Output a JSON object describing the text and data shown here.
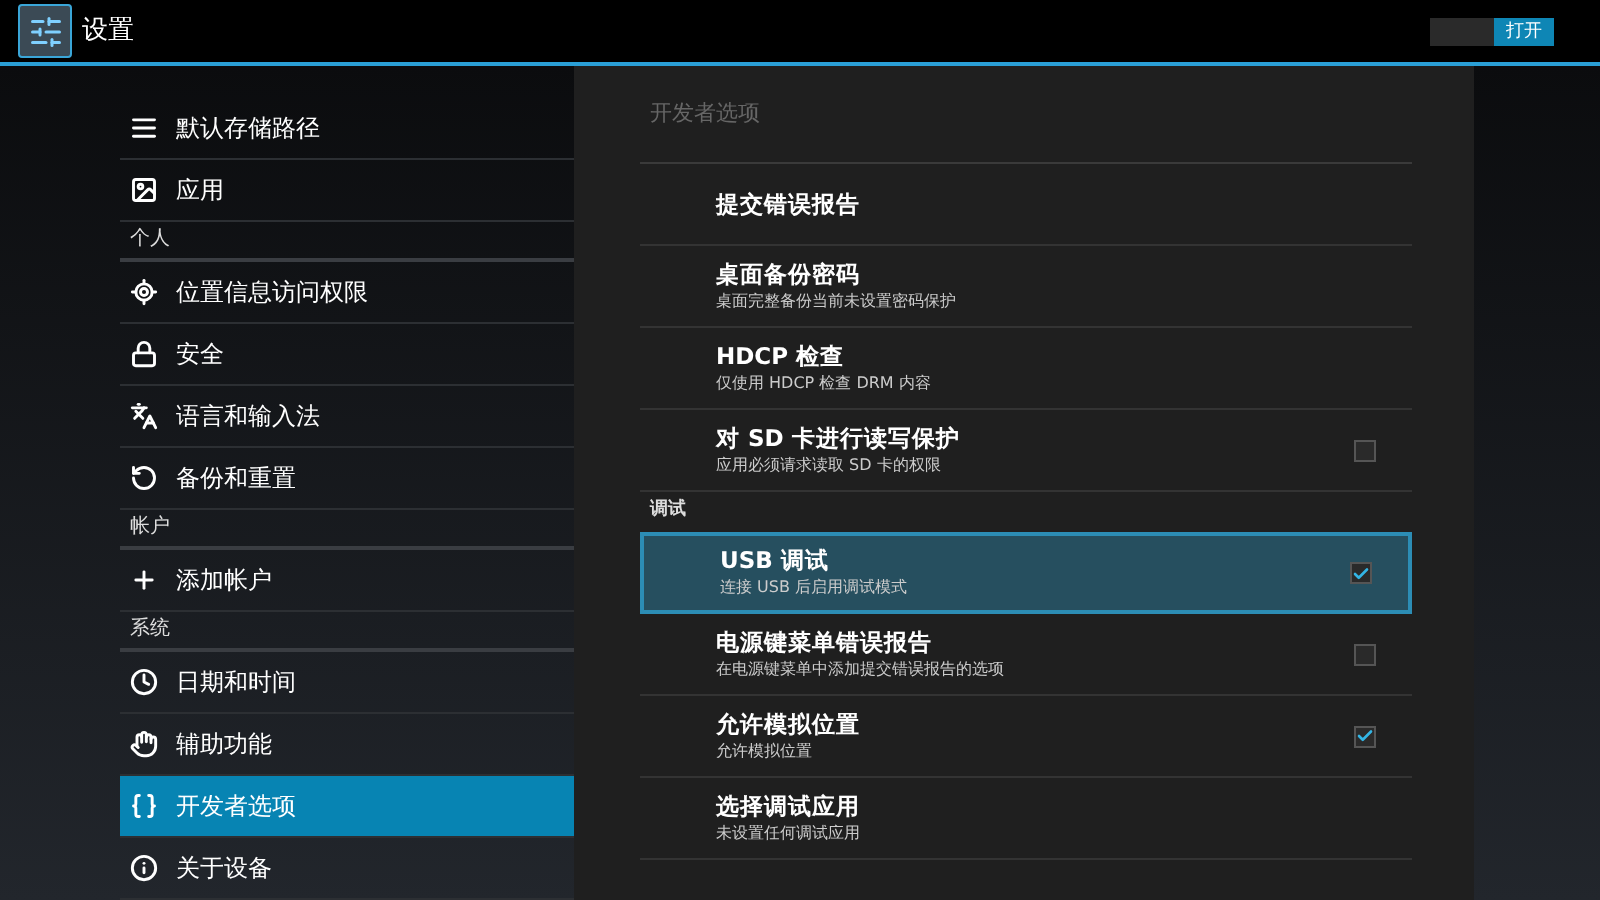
{
  "action_bar": {
    "title": "设置",
    "toggle": {
      "label": "打开",
      "on": true
    }
  },
  "sidebar": {
    "items": [
      {
        "kind": "item",
        "label": "默认存储路径",
        "selected": false
      },
      {
        "kind": "item",
        "label": "应用",
        "selected": false
      },
      {
        "kind": "section",
        "label": "个人"
      },
      {
        "kind": "item",
        "label": "位置信息访问权限",
        "selected": false
      },
      {
        "kind": "item",
        "label": "安全",
        "selected": false
      },
      {
        "kind": "item",
        "label": "语言和输入法",
        "selected": false
      },
      {
        "kind": "item",
        "label": "备份和重置",
        "selected": false
      },
      {
        "kind": "section",
        "label": "帐户"
      },
      {
        "kind": "item",
        "label": "添加帐户",
        "selected": false
      },
      {
        "kind": "section",
        "label": "系统"
      },
      {
        "kind": "item",
        "label": "日期和时间",
        "selected": false
      },
      {
        "kind": "item",
        "label": "辅助功能",
        "selected": false
      },
      {
        "kind": "item",
        "label": "开发者选项",
        "selected": true
      },
      {
        "kind": "item",
        "label": "关于设备",
        "selected": false
      }
    ]
  },
  "panel": {
    "title": "开发者选项",
    "items": [
      {
        "kind": "action",
        "title": "提交错误报告",
        "selected": false
      },
      {
        "kind": "action",
        "title": "桌面备份密码",
        "summary": "桌面完整备份当前未设置密码保护",
        "selected": false
      },
      {
        "kind": "action",
        "title": "HDCP 检查",
        "summary": "仅使用 HDCP 检查 DRM 内容",
        "selected": false
      },
      {
        "kind": "checkbox",
        "title": "对 SD 卡进行读写保护",
        "summary": "应用必须请求读取 SD 卡的权限",
        "checked": false,
        "selected": false
      },
      {
        "kind": "section",
        "title": "调试"
      },
      {
        "kind": "checkbox",
        "title": "USB 调试",
        "summary": "连接 USB 后启用调试模式",
        "checked": true,
        "selected": true
      },
      {
        "kind": "checkbox",
        "title": "电源键菜单错误报告",
        "summary": "在电源键菜单中添加提交错误报告的选项",
        "checked": false,
        "selected": false
      },
      {
        "kind": "checkbox",
        "title": "允许模拟位置",
        "summary": "允许模拟位置",
        "checked": true,
        "selected": false
      },
      {
        "kind": "action",
        "title": "选择调试应用",
        "summary": "未设置任何调试应用",
        "selected": false
      }
    ]
  }
}
